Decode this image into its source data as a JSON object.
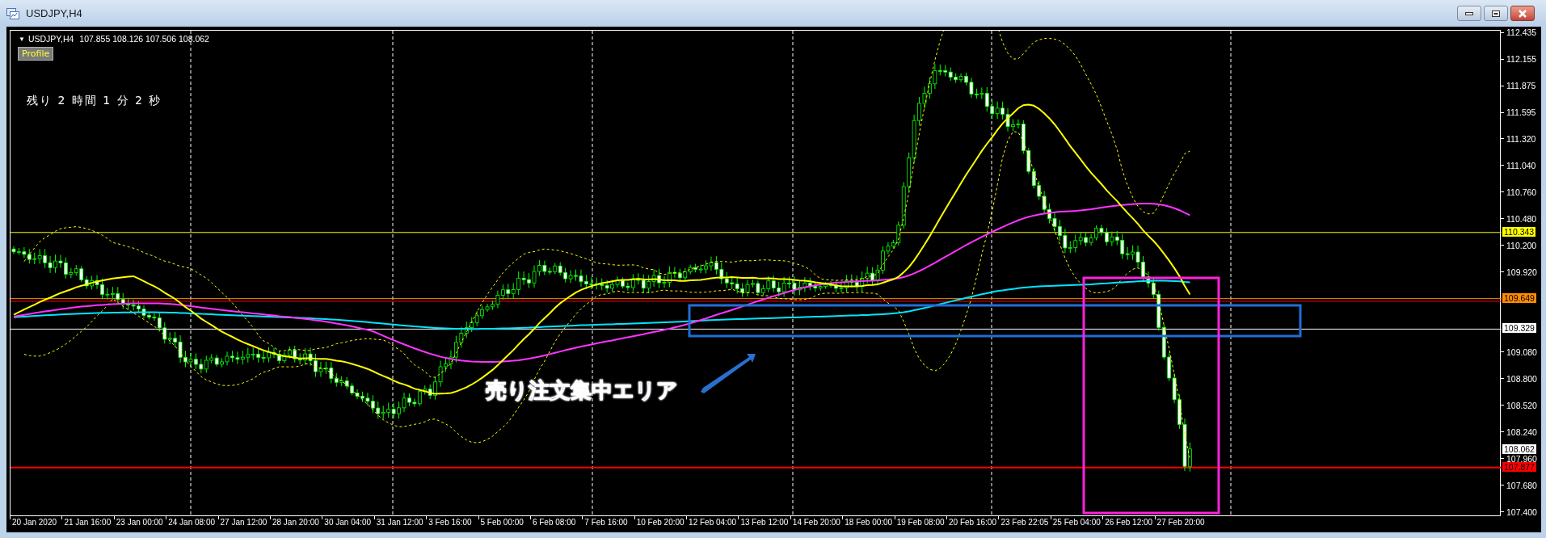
{
  "window": {
    "title": "USDJPY,H4"
  },
  "chart": {
    "header": {
      "arrow": "▼",
      "symbol": "USDJPY,H4",
      "ohlc": "107.855 108.126 107.506 108.062"
    },
    "profile_button": "Profile",
    "countdown": "残り 2 時間 1 分 2 秒",
    "callout": "売り注文集中エリア",
    "price_axis": [
      "112.435",
      "112.155",
      "111.875",
      "111.595",
      "111.320",
      "111.040",
      "110.760",
      "110.480",
      "110.200",
      "109.920",
      "109.080",
      "108.800",
      "108.520",
      "108.240",
      "107.960",
      "107.680",
      "107.400"
    ],
    "price_markers": [
      {
        "label": "110.343",
        "color": "#ffff00"
      },
      {
        "label": "109.649",
        "color": "#ff8c00"
      },
      {
        "label": "109.329",
        "color": "#ffffff"
      },
      {
        "label": "108.062",
        "color": "#ffffff"
      },
      {
        "label": "107.877",
        "color": "#ff0000"
      }
    ],
    "time_axis": [
      "20 Jan 2020",
      "21 Jan 16:00",
      "23 Jan 00:00",
      "24 Jan 08:00",
      "27 Jan 12:00",
      "28 Jan 20:00",
      "30 Jan 04:00",
      "31 Jan 12:00",
      "3 Feb 16:00",
      "5 Feb 00:00",
      "6 Feb 08:00",
      "7 Feb 16:00",
      "10 Feb 20:00",
      "12 Feb 04:00",
      "13 Feb 12:00",
      "14 Feb 20:00",
      "18 Feb 00:00",
      "19 Feb 08:00",
      "20 Feb 16:00",
      "23 Feb 22:05",
      "25 Feb 04:00",
      "26 Feb 12:00",
      "27 Feb 20:00"
    ]
  }
}
